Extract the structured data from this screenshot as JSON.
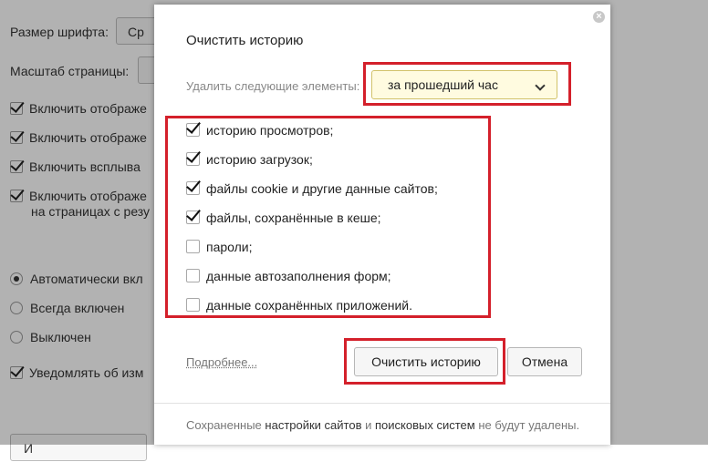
{
  "background": {
    "font_size_label": "Размер шрифта:",
    "font_size_btn": "Ср",
    "page_zoom_label": "Масштаб страницы:",
    "options": [
      {
        "label": "Включить отображе",
        "checked": true
      },
      {
        "label": "Включить отображе",
        "checked": true
      },
      {
        "label": "Включить всплыва",
        "checked": true
      },
      {
        "label": "Включить отображе",
        "checked": true
      }
    ],
    "option_continuation": "на страницах с резу",
    "radios": [
      {
        "label": "Автоматически вкл",
        "selected": true
      },
      {
        "label": "Всегда включен",
        "selected": false
      },
      {
        "label": "Выключен",
        "selected": false
      }
    ],
    "notify_label": "Уведомлять об изм",
    "bottom_btn": "И"
  },
  "dialog": {
    "title": "Очистить историю",
    "period_label": "Удалить следующие элементы:",
    "period_value": "за прошедший час",
    "items": [
      {
        "label": "историю просмотров;",
        "checked": true
      },
      {
        "label": "историю загрузок;",
        "checked": true
      },
      {
        "label": "файлы cookie и другие данные сайтов;",
        "checked": true
      },
      {
        "label": "файлы, сохранённые в кеше;",
        "checked": true
      },
      {
        "label": "пароли;",
        "checked": false
      },
      {
        "label": "данные автозаполнения форм;",
        "checked": false
      },
      {
        "label": "данные сохранённых приложений.",
        "checked": false
      }
    ],
    "more_link": "Подробнее...",
    "clear_button": "Очистить историю",
    "cancel_button": "Отмена",
    "footer": {
      "part1": "Сохраненные",
      "part2": "настройки сайтов",
      "part3": "и",
      "part4": "поисковых систем",
      "part5": "не будут удалены."
    }
  },
  "colors": {
    "highlight": "#d4202b",
    "select_bg": "#fffbe0"
  }
}
